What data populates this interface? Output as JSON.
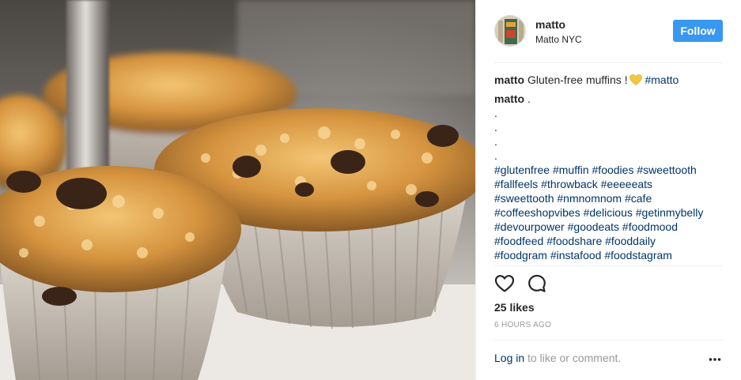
{
  "post": {
    "image_alt": "Gluten-free muffins",
    "header": {
      "username": "matto",
      "location": "Matto NYC",
      "follow_label": "Follow"
    },
    "caption": {
      "username": "matto",
      "text": "Gluten-free muffins !",
      "emoji": "yellow-heart",
      "hashtag": "#matto"
    },
    "comment": {
      "username": "matto",
      "text": ".",
      "dots": [
        ".",
        ".",
        ".",
        "."
      ],
      "hashtags": [
        "#glutenfree",
        "#muffin",
        "#foodies",
        "#sweettooth",
        "#fallfeels",
        "#throwback",
        "#eeeeeats",
        "#sweettooth",
        "#nmnomnom",
        "#cafe",
        "#coffeeshopvibes",
        "#delicious",
        "#getinmybelly",
        "#devourpower",
        "#goodeats",
        "#foodmood",
        "#foodfeed",
        "#foodshare",
        "#fooddaily",
        "#foodgram",
        "#instafood",
        "#foodstagram"
      ]
    },
    "actions": {
      "like_icon": "heart-outline-icon",
      "comment_icon": "comment-bubble-icon"
    },
    "likes": "25 likes",
    "time": "6 HOURS AGO",
    "footer": {
      "login_label": "Log in",
      "suffix": " to like or comment.",
      "more_icon": "ellipsis-icon"
    },
    "colors": {
      "follow_button": "#3897f0",
      "hashtag": "#003569",
      "muted": "#999999",
      "emoji_heart": "#f5c73c"
    }
  }
}
